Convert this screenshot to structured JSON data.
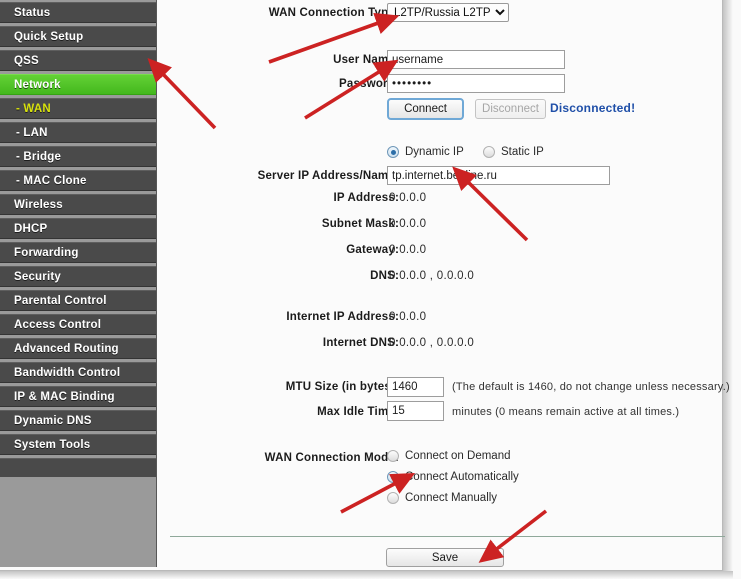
{
  "sidebar": {
    "items": [
      {
        "label": "Status",
        "state": "normal"
      },
      {
        "label": "Quick Setup",
        "state": "normal"
      },
      {
        "label": "QSS",
        "state": "normal"
      },
      {
        "label": "Network",
        "state": "active"
      },
      {
        "label": "- WAN",
        "state": "sub-active"
      },
      {
        "label": "- LAN",
        "state": "sub"
      },
      {
        "label": "- Bridge",
        "state": "sub"
      },
      {
        "label": "- MAC Clone",
        "state": "sub"
      },
      {
        "label": "Wireless",
        "state": "normal"
      },
      {
        "label": "DHCP",
        "state": "normal"
      },
      {
        "label": "Forwarding",
        "state": "normal"
      },
      {
        "label": "Security",
        "state": "normal"
      },
      {
        "label": "Parental Control",
        "state": "normal"
      },
      {
        "label": "Access Control",
        "state": "normal"
      },
      {
        "label": "Advanced Routing",
        "state": "normal"
      },
      {
        "label": "Bandwidth Control",
        "state": "normal"
      },
      {
        "label": "IP & MAC Binding",
        "state": "normal"
      },
      {
        "label": "Dynamic DNS",
        "state": "normal"
      },
      {
        "label": "System Tools",
        "state": "normal"
      }
    ]
  },
  "form": {
    "wan_connection_type": {
      "label": "WAN Connection Type:",
      "value": "L2TP/Russia L2TP"
    },
    "user_name": {
      "label": "User Name:",
      "value": "username"
    },
    "password": {
      "label": "Password:",
      "value": "••••••••"
    },
    "connect_button": "Connect",
    "disconnect_button": "Disconnect",
    "connection_status": "Disconnected!",
    "ip_mode": {
      "dynamic_label": "Dynamic IP",
      "static_label": "Static IP",
      "selected": "dynamic"
    },
    "server_ip": {
      "label": "Server IP Address/Name:",
      "value": "tp.internet.beeline.ru"
    },
    "readonly_rows": [
      {
        "label": "IP Address:",
        "value": "0.0.0.0"
      },
      {
        "label": "Subnet Mask:",
        "value": "0.0.0.0"
      },
      {
        "label": "Gateway:",
        "value": "0.0.0.0"
      },
      {
        "label": "DNS:",
        "value": "0.0.0.0 , 0.0.0.0"
      }
    ],
    "internet_rows": [
      {
        "label": "Internet IP Address:",
        "value": "0.0.0.0"
      },
      {
        "label": "Internet DNS:",
        "value": "0.0.0.0 , 0.0.0.0"
      }
    ],
    "mtu": {
      "label": "MTU Size (in bytes):",
      "value": "1460",
      "hint": "(The default is 1460, do not change unless necessary.)"
    },
    "max_idle": {
      "label": "Max Idle Time:",
      "value": "15",
      "hint": "minutes (0 means remain active at all times.)"
    },
    "connection_mode": {
      "label": "WAN Connection Mode:",
      "options": [
        {
          "label": "Connect on Demand",
          "checked": false
        },
        {
          "label": "Connect Automatically",
          "checked": true
        },
        {
          "label": "Connect Manually",
          "checked": false
        }
      ]
    },
    "save_button": "Save"
  },
  "colors": {
    "accent_green": "#4dc425",
    "sidebar_item": "#4a4a4a",
    "sidebar_bg": "#9a9a9a",
    "sub_active_text": "#d8e20d",
    "status_blue": "#1f4fa8",
    "annotation_red": "#cc2222",
    "divider": "#8fa89a"
  }
}
